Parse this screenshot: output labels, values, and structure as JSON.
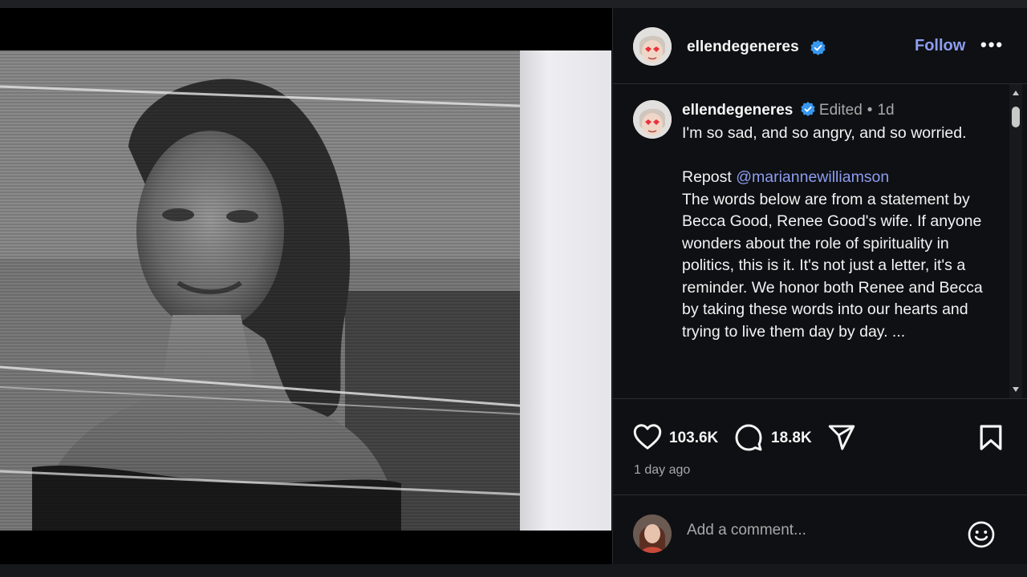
{
  "post": {
    "username": "ellendegeneres",
    "follow_label": "Follow",
    "more_label": "•••",
    "edited_label": "Edited",
    "separator": "•",
    "age_short": "1d",
    "caption_line1": "I'm so sad, and so angry, and so worried.",
    "repost_label": "Repost",
    "repost_mention": "@mariannewilliamson",
    "caption_body": "The words below are from a statement by Becca Good, Renee Good's wife. If anyone wonders about the role of spirituality in politics, this is it. It's not just a letter, it's a reminder. We honor both Renee and Becca by taking these words into our hearts and trying to live them day by day. ...",
    "likes": "103.6K",
    "comments": "18.8K",
    "time_ago": "1 day ago",
    "comment_placeholder": "Add a comment..."
  },
  "icons": {
    "like": "heart-icon",
    "comment": "speech-bubble-icon",
    "share": "paper-plane-icon",
    "save": "bookmark-icon",
    "emoji": "smiley-icon",
    "verified": "verified-badge-icon",
    "more": "more-dots-icon"
  },
  "colors": {
    "panel_bg": "#0e1013",
    "link_blue": "#8e9df0",
    "verified_blue": "#3797f0",
    "muted": "#a8a8a8"
  }
}
